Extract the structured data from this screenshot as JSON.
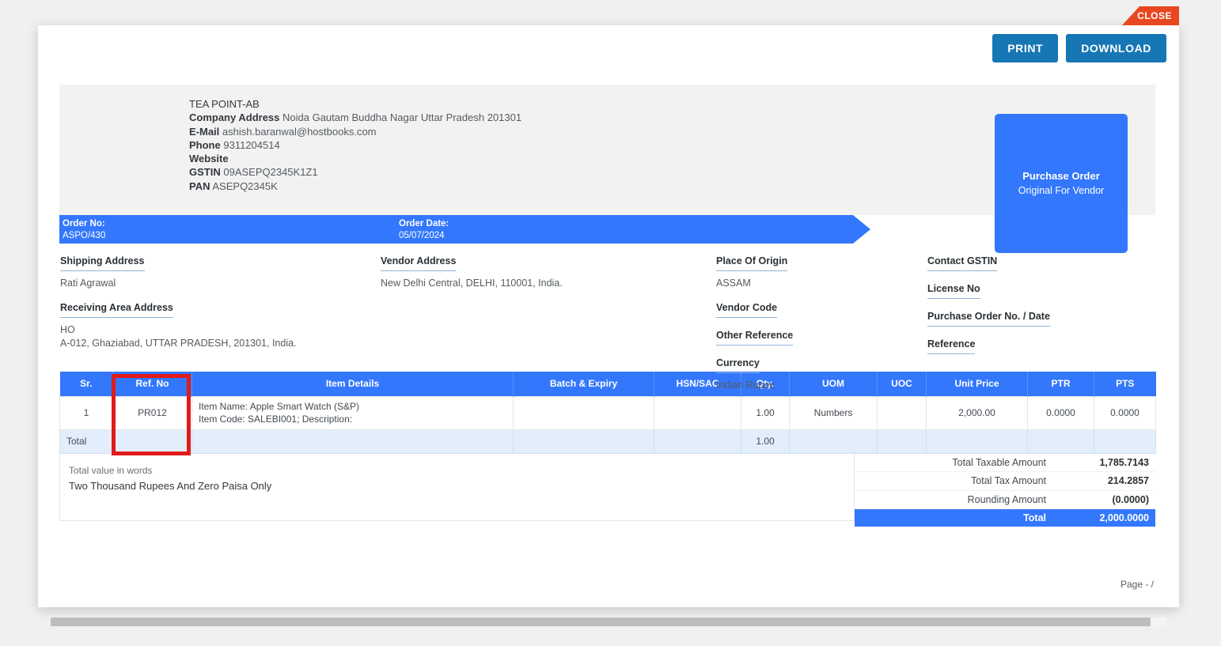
{
  "ribbon": {
    "close_label": "CLOSE"
  },
  "toolbar": {
    "print_label": "PRINT",
    "download_label": "DOWNLOAD"
  },
  "company": {
    "name": "TEA POINT-AB",
    "address_label": "Company Address",
    "address_value": "Noida Gautam Buddha Nagar Uttar Pradesh 201301",
    "email_label": "E-Mail",
    "email_value": "ashish.baranwal@hostbooks.com",
    "phone_label": "Phone",
    "phone_value": "9311204514",
    "website_label": "Website",
    "website_value": "",
    "gstin_label": "GSTIN",
    "gstin_value": "09ASEPQ2345K1Z1",
    "pan_label": "PAN",
    "pan_value": "ASEPQ2345K"
  },
  "doctype": {
    "title": "Purchase Order",
    "subtitle": "Original For Vendor"
  },
  "order_banner": {
    "order_no_label": "Order No:",
    "order_no_value": "ASPO/430",
    "order_date_label": "Order Date:",
    "order_date_value": "05/07/2024"
  },
  "details": {
    "shipping_address_label": "Shipping Address",
    "shipping_address_value": "Rati Agrawal",
    "receiving_area_label": "Receiving Area Address",
    "receiving_area_line1": "HO",
    "receiving_area_line2": "A-012, Ghaziabad, UTTAR PRADESH, 201301, India.",
    "vendor_address_label": "Vendor Address",
    "vendor_address_value": "New Delhi Central, DELHI, 110001, India.",
    "place_of_origin_label": "Place Of Origin",
    "place_of_origin_value": "ASSAM",
    "vendor_code_label": "Vendor Code",
    "vendor_code_value": "",
    "other_reference_label": "Other Reference",
    "other_reference_value": "",
    "currency_label": "Currency",
    "currency_value": "Indian Rupee",
    "contact_gstin_label": "Contact GSTIN",
    "contact_gstin_value": "",
    "license_no_label": "License No",
    "license_no_value": "",
    "po_no_date_label": "Purchase Order No. / Date",
    "po_no_date_value": "",
    "reference_label": "Reference",
    "reference_value": ""
  },
  "items_table": {
    "headers": {
      "sr": "Sr.",
      "ref_no": "Ref. No",
      "item_details": "Item Details",
      "batch_expiry": "Batch & Expiry",
      "hsn_sac": "HSN/SAC",
      "qty": "Qty.",
      "uom": "UOM",
      "uoc": "UOC",
      "unit_price": "Unit Price",
      "ptr": "PTR",
      "pts": "PTS"
    },
    "rows": [
      {
        "sr": "1",
        "ref_no": "PR012",
        "item_name": "Item Name: Apple Smart Watch (S&P)",
        "item_code": "Item Code: SALEBI001; Description:",
        "batch_expiry": "",
        "hsn_sac": "",
        "qty": "1.00",
        "uom": "Numbers",
        "uoc": "",
        "unit_price": "2,000.00",
        "ptr": "0.0000",
        "pts": "0.0000"
      }
    ],
    "total_row": {
      "label": "Total",
      "qty": "1.00"
    }
  },
  "summary": {
    "words_label": "Total value in words",
    "words_value": "Two Thousand Rupees And Zero Paisa Only",
    "totals": [
      {
        "key": "Total Taxable Amount",
        "value": "1,785.7143"
      },
      {
        "key": "Total Tax Amount",
        "value": "214.2857"
      },
      {
        "key": "Rounding Amount",
        "value": "(0.0000)"
      }
    ],
    "grand_total": {
      "key": "Total",
      "value": "2,000.0000"
    }
  },
  "footer": {
    "page_label": "Page - /"
  },
  "colors": {
    "banner_blue": "#3377fc",
    "button_blue": "#1777b5",
    "close_red": "#e8471f",
    "highlight_red": "#e01b1b",
    "total_row_blue": "#e2eefb"
  }
}
